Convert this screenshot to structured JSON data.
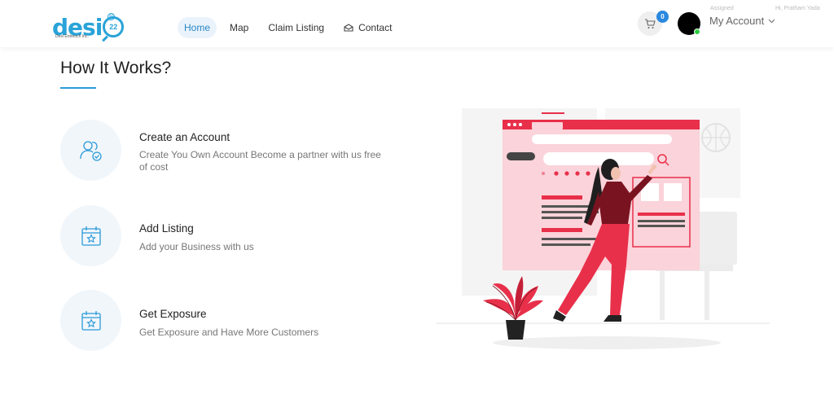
{
  "brand": {
    "logo_text": "desi",
    "logo_number": "22",
    "logo_tagline": "Desi Entrench Inc.",
    "registered_mark": "®"
  },
  "nav": {
    "items": [
      {
        "label": "Home",
        "active": true
      },
      {
        "label": "Map",
        "active": false
      },
      {
        "label": "Claim Listing",
        "active": false
      },
      {
        "label": "Contact",
        "active": false,
        "icon": "envelope-icon"
      }
    ]
  },
  "header_right": {
    "faint_left": "Assigned",
    "faint_right": "Hi, Pratham Yada",
    "cart_count": "0",
    "account_label": "My Account"
  },
  "section": {
    "title": "How It Works?"
  },
  "steps": [
    {
      "title": "Create an Account",
      "description": "Create You Own Account Become a partner with us free of cost",
      "icon": "users-check-icon"
    },
    {
      "title": "Add Listing",
      "description": "Add your Business with us",
      "icon": "calendar-star-icon"
    },
    {
      "title": "Get Exposure",
      "description": "Get Exposure and Have More Customers",
      "icon": "calendar-star-icon"
    }
  ],
  "colors": {
    "accent": "#2a9ad8",
    "nav_active_bg": "#eaf3fb",
    "illustration_red": "#e8304a",
    "illustration_pink": "#fbd3da"
  }
}
